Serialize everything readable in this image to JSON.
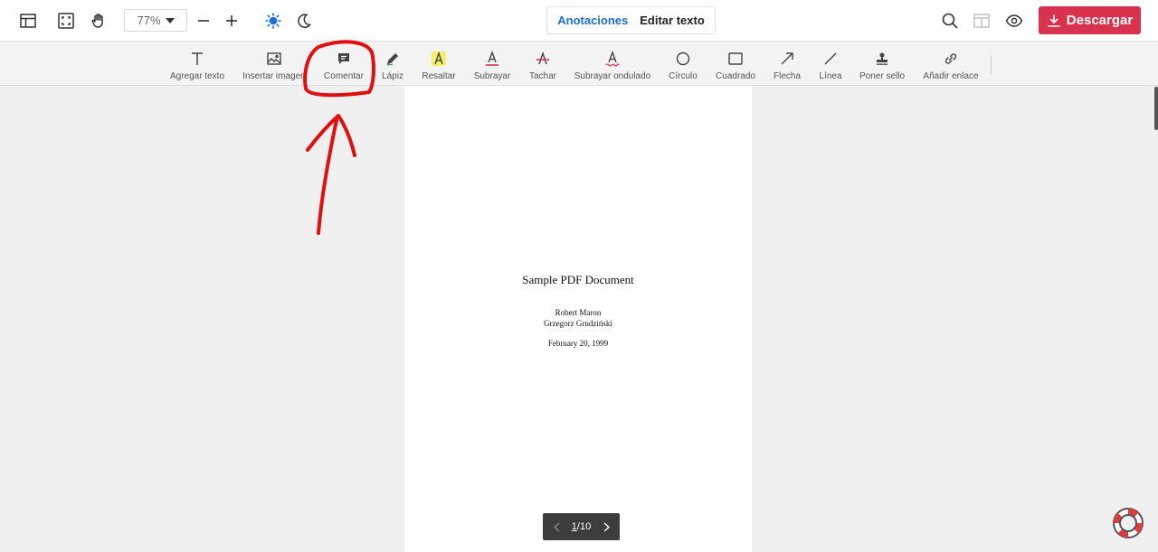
{
  "topbar": {
    "zoom_level": "77%",
    "mode_tabs": [
      {
        "label": "Anotaciones",
        "active": true
      },
      {
        "label": "Editar texto",
        "active": false
      }
    ],
    "download_label": "Descargar",
    "icons": [
      "layout-icon",
      "fullscreen-icon",
      "hand-icon",
      "zoom-out-icon",
      "zoom-in-icon",
      "light-mode-icon",
      "dark-mode-icon",
      "search-icon",
      "panel-icon",
      "eye-icon",
      "download-icon"
    ]
  },
  "toolbar": {
    "tools": [
      {
        "label": "Agregar texto",
        "icon": "text-icon"
      },
      {
        "label": "Insertar imagen",
        "icon": "image-icon"
      },
      {
        "label": "Comentar",
        "icon": "comment-icon"
      },
      {
        "label": "Lápiz",
        "icon": "pencil-icon"
      },
      {
        "label": "Resaltar",
        "icon": "highlight-icon"
      },
      {
        "label": "Subrayar",
        "icon": "underline-icon"
      },
      {
        "label": "Tachar",
        "icon": "strikethrough-icon"
      },
      {
        "label": "Subrayar ondulado",
        "icon": "wavy-underline-icon"
      },
      {
        "label": "Círculo",
        "icon": "circle-icon"
      },
      {
        "label": "Cuadrado",
        "icon": "square-icon"
      },
      {
        "label": "Flecha",
        "icon": "arrow-icon"
      },
      {
        "label": "Línea",
        "icon": "line-icon"
      },
      {
        "label": "Poner sello",
        "icon": "stamp-icon"
      },
      {
        "label": "Añadir enlace",
        "icon": "link-icon"
      }
    ]
  },
  "document": {
    "title": "Sample PDF Document",
    "authors": [
      "Robert Maron",
      "Grzegorz Grudziński"
    ],
    "date": "February 20, 1999"
  },
  "pager": {
    "current": "1",
    "total": "10",
    "separator": "/"
  },
  "colors": {
    "accent": "#1a6fd6",
    "download": "#d8324f",
    "annotation": "#e01010",
    "highlight": "#f3f06a"
  }
}
